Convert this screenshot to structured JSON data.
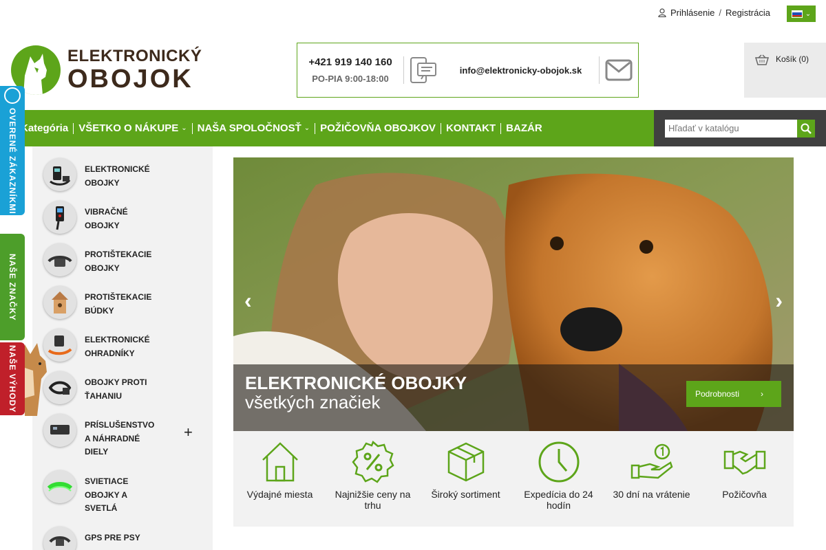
{
  "header": {
    "login_label": "Prihlásenie",
    "separator": "/",
    "register_label": "Registrácia"
  },
  "logo": {
    "line1": "ELEKTRONICKÝ",
    "line2": "OBOJOK"
  },
  "contact": {
    "phone": "+421 919 140 160",
    "hours": "PO-PIA 9:00-18:00",
    "email": "info@elektronicky-obojok.sk"
  },
  "cart": {
    "label": "Košík (0)"
  },
  "nav": {
    "items": [
      {
        "label": "Kategória",
        "has_dropdown": false
      },
      {
        "label": "VŠETKO O NÁKUPE",
        "has_dropdown": true
      },
      {
        "label": "NAŠA SPOLOČNOSŤ",
        "has_dropdown": true
      },
      {
        "label": "POŽIČOVŇA OBOJKOV",
        "has_dropdown": false
      },
      {
        "label": "KONTAKT",
        "has_dropdown": false
      },
      {
        "label": "BAZÁR",
        "has_dropdown": false
      }
    ]
  },
  "search": {
    "placeholder": "Hľadať v katalógu"
  },
  "side_tabs": {
    "verified": "OVERENÉ ZÁKAZNÍKMI",
    "brands": "NAŠE ZNAČKY",
    "benefits": "NAŠE VÝHODY"
  },
  "sidebar": {
    "categories": [
      {
        "label": "ELEKTRONICKÉ OBOJKY",
        "icon": "collar-remote-icon"
      },
      {
        "label": "VIBRAČNÉ OBOJKY",
        "icon": "vibration-collar-icon"
      },
      {
        "label": "PROTIŠTEKACIE OBOJKY",
        "icon": "antibark-collar-icon"
      },
      {
        "label": "PROTIŠTEKACIE BÚDKY",
        "icon": "birdhouse-icon"
      },
      {
        "label": "ELEKTRONICKÉ OHRADNÍKY",
        "icon": "fence-icon"
      },
      {
        "label": "OBOJKY PROTI ŤAHANIU",
        "icon": "pull-collar-icon"
      },
      {
        "label": "PRÍSLUŠENSTVO A NÁHRADNÉ DIELY",
        "icon": "accessories-icon",
        "expandable": true
      },
      {
        "label": "SVIETIACE OBOJKY A SVETLÁ",
        "icon": "led-collar-icon"
      },
      {
        "label": "GPS PRE PSY",
        "icon": "gps-collar-icon"
      }
    ]
  },
  "hero": {
    "title": "ELEKTRONICKÉ OBOJKY",
    "subtitle": "všetkých značiek",
    "button_label": "Podrobnosti"
  },
  "features": {
    "items": [
      {
        "label": "Výdajné miesta",
        "icon": "house-icon"
      },
      {
        "label": "Najnižšie ceny na trhu",
        "icon": "percent-badge-icon"
      },
      {
        "label": "Široký sortiment",
        "icon": "box-icon"
      },
      {
        "label": "Expedícia do 24 hodín",
        "icon": "clock-icon"
      },
      {
        "label": "30 dní na vrátenie",
        "icon": "hand-coin-icon"
      },
      {
        "label": "Požičovňa",
        "icon": "handshake-icon"
      }
    ]
  },
  "colors": {
    "brand_green": "#5da51a",
    "logo_brown": "#3d2a1c",
    "tab_blue": "#1aa1d6",
    "tab_red": "#c0202a"
  }
}
